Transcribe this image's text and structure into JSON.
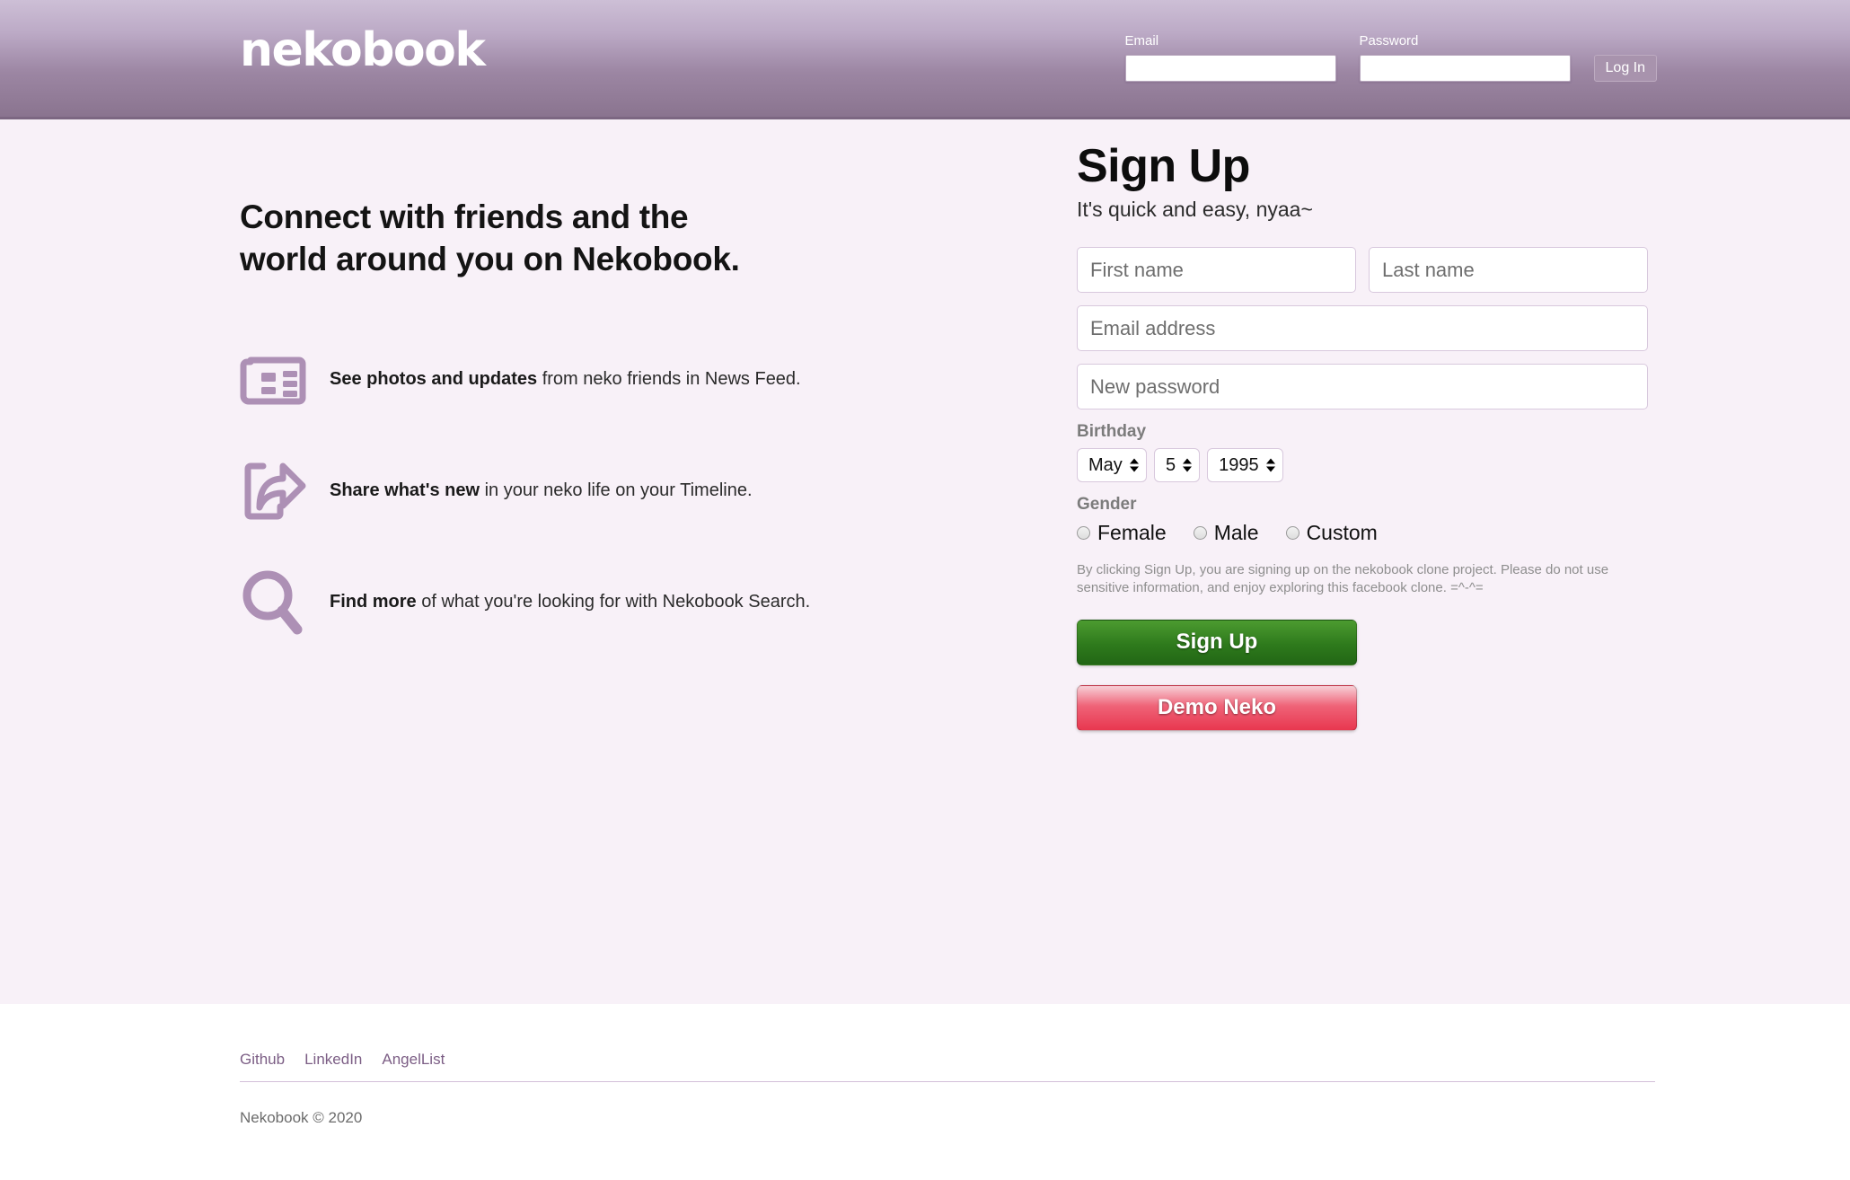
{
  "header": {
    "logo": "nekobook",
    "login": {
      "email_label": "Email",
      "email_value": "",
      "email_placeholder": "",
      "password_label": "Password",
      "password_value": "",
      "password_placeholder": "",
      "button_label": "Log In"
    },
    "colors": {
      "gradient_top": "#cdbfd6",
      "gradient_bottom": "#8a748f",
      "button_bg": "#a893ad"
    }
  },
  "main": {
    "background": "#f8f1f8",
    "headline_line1": "Connect with friends and the",
    "headline_line2": "world around you on Nekobook.",
    "features": [
      {
        "icon": "newspaper-icon",
        "bold": "See photos and updates",
        "rest": " from neko friends in News Feed."
      },
      {
        "icon": "share-icon",
        "bold": "Share what's new",
        "rest": " in your neko life on your Timeline."
      },
      {
        "icon": "search-icon",
        "bold": "Find more",
        "rest": " of what you're looking for with Nekobook Search."
      }
    ],
    "icon_color": "#ad90b5"
  },
  "signup": {
    "title": "Sign Up",
    "subtitle": "It's quick and easy, nyaa~",
    "first_name_placeholder": "First name",
    "first_name_value": "",
    "last_name_placeholder": "Last name",
    "last_name_value": "",
    "email_placeholder": "Email address",
    "email_value": "",
    "password_placeholder": "New password",
    "password_value": "",
    "birthday_label": "Birthday",
    "birthday": {
      "month": "May",
      "day": "5",
      "year": "1995"
    },
    "gender_label": "Gender",
    "gender_options": [
      "Female",
      "Male",
      "Custom"
    ],
    "gender_selected": "",
    "disclaimer": "By clicking Sign Up, you are signing up on the nekobook clone project. Please do not use sensitive information, and enjoy exploring this facebook clone. =^-^=",
    "signup_button": "Sign Up",
    "demo_button": "Demo Neko",
    "colors": {
      "signup_green": "#2e7a1c",
      "demo_red": "#e8374f"
    }
  },
  "footer": {
    "links": [
      "Github",
      "LinkedIn",
      "AngelList"
    ],
    "copyright": "Nekobook © 2020",
    "link_color": "#7c5e85"
  }
}
